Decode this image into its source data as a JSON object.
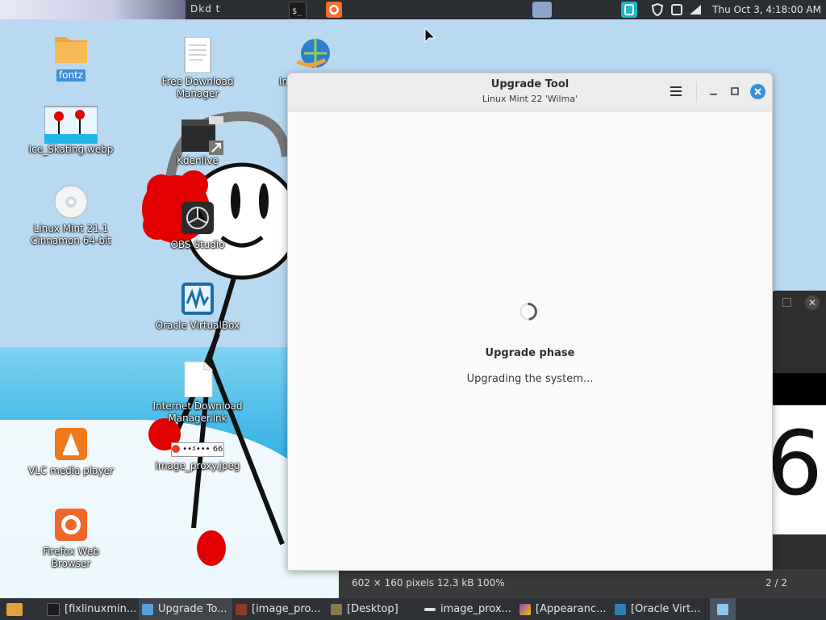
{
  "top_panel": {
    "title": "Dkd t",
    "clock": "Thu Oct  3,  4:18:00 AM"
  },
  "desktop": {
    "icons": [
      {
        "label": "fontz"
      },
      {
        "label": "Ice_Skating.webp"
      },
      {
        "label": "Linux Mint 21.1 Cinnamon 64-bit"
      },
      {
        "label": "VLC media player"
      },
      {
        "label": "Firefox Web Browser"
      },
      {
        "label": "Free Download Manager"
      },
      {
        "label": "Kdenlive"
      },
      {
        "label": "OBS Studio"
      },
      {
        "label": "Oracle VirtualBox"
      },
      {
        "label": "Internet Download Manager.lnk"
      },
      {
        "label": "image_proxy.jpeg"
      },
      {
        "label": "In"
      }
    ],
    "image_proxy_thumb_text": "••♯••• 666"
  },
  "window": {
    "title": "Upgrade Tool",
    "subtitle": "Linux Mint 22 'Wilma'",
    "phase": "Upgrade phase",
    "phase_desc": "Upgrading the system..."
  },
  "viewer": {
    "info": "602 × 160 pixels  12.3 kB   100%",
    "page": "2 / 2",
    "big_char": "6"
  },
  "taskbar": {
    "items": [
      {
        "label": "[fixlinuxmin..."
      },
      {
        "label": "Upgrade To..."
      },
      {
        "label": "[image_pro..."
      },
      {
        "label": "[Desktop]"
      },
      {
        "label": "image_prox..."
      },
      {
        "label": "[Appearanc..."
      },
      {
        "label": "[Oracle Virt..."
      }
    ]
  },
  "colors": {
    "accent": "#3a8fd7",
    "panel": "#2b2e33",
    "taskbar": "#2e3136"
  }
}
